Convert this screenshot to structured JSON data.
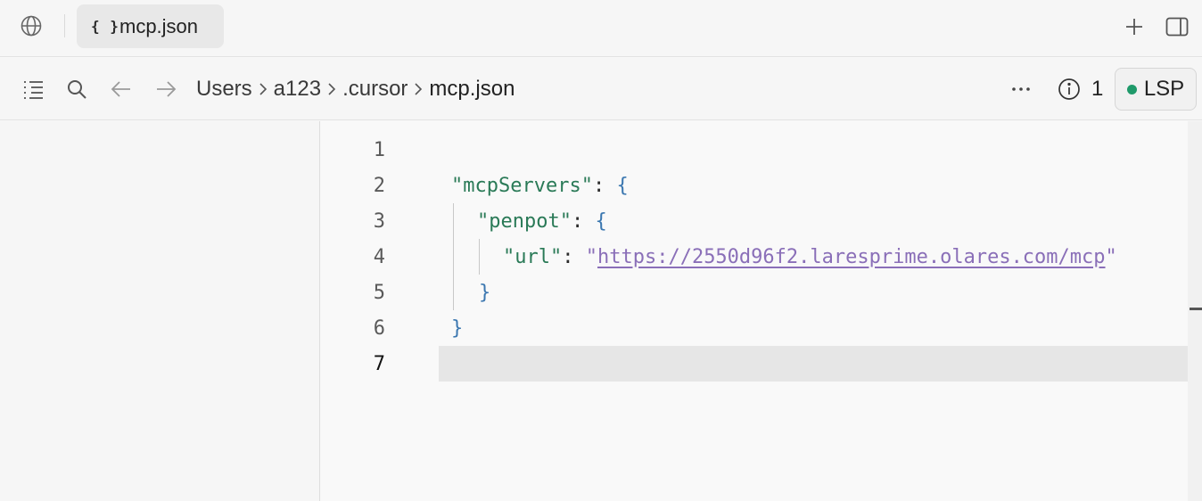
{
  "tabbar": {
    "tab": {
      "icon_text": "{ }",
      "label": "mcp.json"
    }
  },
  "toolbar": {
    "breadcrumb": [
      "Users",
      "a123",
      ".cursor",
      "mcp.json"
    ],
    "diagnostics_count": "1",
    "lsp_label": "LSP",
    "lsp_status_color": "#1f9a6a"
  },
  "editor": {
    "line_numbers": [
      "1",
      "2",
      "3",
      "4",
      "5",
      "6",
      "7"
    ],
    "active_line": "7",
    "lines": [
      {
        "tokens": []
      },
      {
        "tokens": [
          "\"mcpServers\"",
          ": ",
          "{"
        ]
      },
      {
        "tokens": [
          "\"penpot\"",
          ": ",
          "{"
        ]
      },
      {
        "tokens": [
          "\"url\"",
          ": ",
          "\"",
          "https://2550d96f2.laresprime.olares.com/mcp",
          "\""
        ]
      },
      {
        "tokens": [
          "}"
        ]
      },
      {
        "tokens": [
          "}"
        ]
      },
      {
        "tokens": []
      }
    ]
  },
  "colors": {
    "key": "#2a7a57",
    "brace": "#3b77b0",
    "string": "#8a6fb8"
  }
}
